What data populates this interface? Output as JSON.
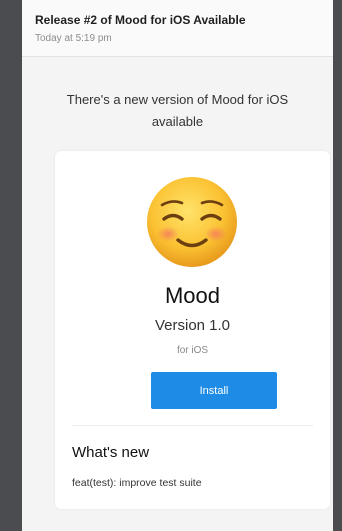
{
  "email": {
    "subject": "Release #2 of Mood for iOS Available",
    "received": "Today at 5:19 pm"
  },
  "body": {
    "intro_line1": "There's a new version of Mood for iOS",
    "intro_line2": "available"
  },
  "card": {
    "icon": "smiling-face-emoji",
    "app_name": "Mood",
    "version": "Version 1.0",
    "platform": "for iOS",
    "install_label": "Install",
    "whats_new_heading": "What's new",
    "changelog": "feat(test): improve test suite"
  },
  "colors": {
    "background": "#47494c",
    "accent": "#1e8ce6",
    "card": "#ffffff"
  }
}
